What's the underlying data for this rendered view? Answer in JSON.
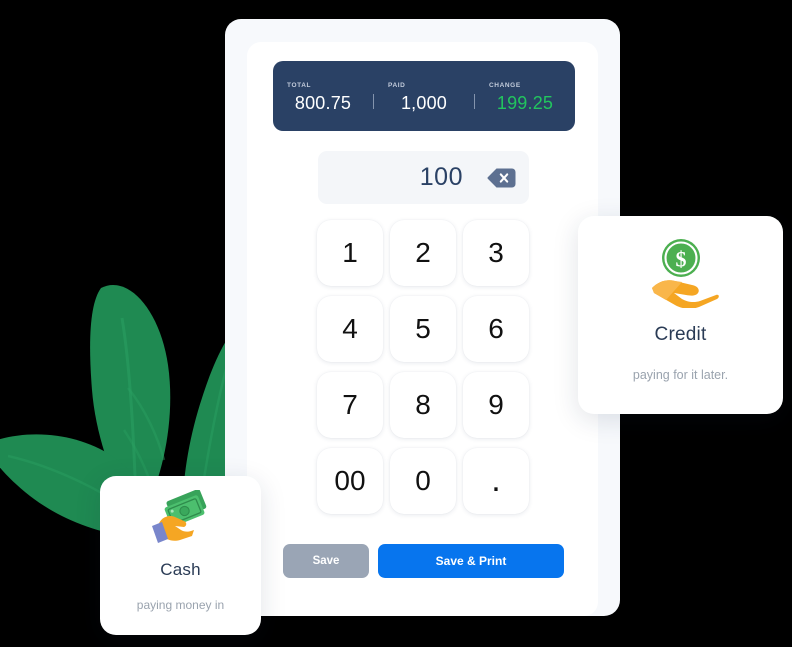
{
  "summary": {
    "cells": [
      {
        "label": "TOTAL",
        "value": "800.75",
        "accent": false
      },
      {
        "label": "PAID",
        "value": "1,000",
        "accent": false
      },
      {
        "label": "CHANGE",
        "value": "199.25",
        "accent": true
      }
    ]
  },
  "display": {
    "value": "100",
    "backspace_icon": "backspace-icon"
  },
  "keypad": {
    "keys": [
      "1",
      "2",
      "3",
      "4",
      "5",
      "6",
      "7",
      "8",
      "9",
      "00",
      "0",
      "."
    ]
  },
  "actions": {
    "save_label": "Save",
    "save_print_label": "Save & Print"
  },
  "payment_cards": [
    {
      "id": "credit",
      "icon": "money-with-hand-icon",
      "title": "Credit",
      "subtitle": "paying for it later."
    },
    {
      "id": "cash",
      "icon": "hand-holding-cash-icon",
      "title": "Cash",
      "subtitle": "paying money in"
    }
  ],
  "decoration": {
    "plant_icon": "plant-leaves-icon"
  },
  "colors": {
    "summary_bar": "#2a4165",
    "change_accent": "#22c55e",
    "primary_button": "#0775ee",
    "secondary_button": "#9aa5b5",
    "display_bg": "#f4f6f9",
    "plant_green": "#1f8a52"
  }
}
